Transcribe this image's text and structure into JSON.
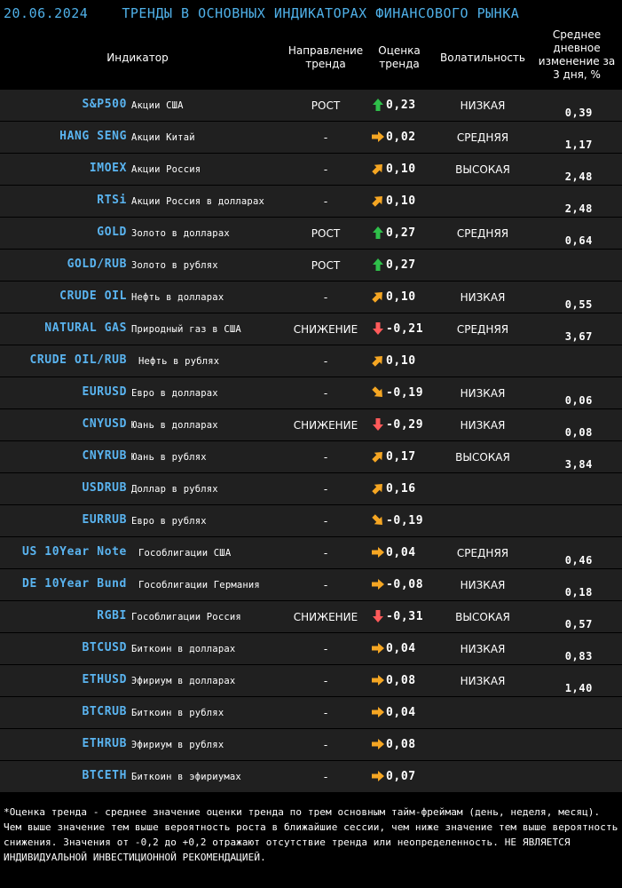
{
  "title_bar": {
    "date": "20.06.2024",
    "title": "ТРЕНДЫ В ОСНОВНЫХ ИНДИКАТОРАХ ФИНАНСОВОГО РЫНКА"
  },
  "columns": {
    "indicator": "Индикатор",
    "direction_line1": "Направление",
    "direction_line2": "тренда",
    "score_line1": "Оценка",
    "score_line2": "тренда",
    "volatility": "Волатильность",
    "avg_line1": "Среднее",
    "avg_line2": "дневное",
    "avg_line3": "изменение за",
    "avg_line4": "3 дня, %"
  },
  "colors": {
    "ticker": "#5ab4f0",
    "up_arrow": "#2fbf4a",
    "down_arrow": "#ff5a5a",
    "side_arrow": "#f5a623"
  },
  "rows": [
    {
      "ticker": "S&P500",
      "desc": "Акции США",
      "direction": "РОСТ",
      "arrow": "up",
      "score": "0,23",
      "volatility": "НИЗКАЯ",
      "avg": "0,39"
    },
    {
      "ticker": "HANG SENG",
      "desc": "Акции Китай",
      "direction": "-",
      "arrow": "right",
      "score": "0,02",
      "volatility": "СРЕДНЯЯ",
      "avg": "1,17"
    },
    {
      "ticker": "IMOEX",
      "desc": "Акции Россия",
      "direction": "-",
      "arrow": "up-right",
      "score": "0,10",
      "volatility": "ВЫСОКАЯ",
      "avg": "2,48"
    },
    {
      "ticker": "RTSi",
      "desc": "Акции Россия в долларах",
      "direction": "-",
      "arrow": "up-right",
      "score": "0,10",
      "volatility": "",
      "avg": "2,48"
    },
    {
      "ticker": "GOLD",
      "desc": "Золото в долларах",
      "direction": "РОСТ",
      "arrow": "up",
      "score": "0,27",
      "volatility": "СРЕДНЯЯ",
      "avg": "0,64"
    },
    {
      "ticker": "GOLD/RUB",
      "desc": "Золото в рублях",
      "direction": "РОСТ",
      "arrow": "up",
      "score": "0,27",
      "volatility": "",
      "avg": ""
    },
    {
      "ticker": "CRUDE OIL",
      "desc": "Нефть в долларах",
      "direction": "-",
      "arrow": "up-right",
      "score": "0,10",
      "volatility": "НИЗКАЯ",
      "avg": "0,55"
    },
    {
      "ticker": "NATURAL GAS",
      "desc": "Природный газ в США",
      "direction": "СНИЖЕНИЕ",
      "arrow": "down",
      "score": "-0,21",
      "volatility": "СРЕДНЯЯ",
      "avg": "3,67"
    },
    {
      "ticker": "CRUDE OIL/RUB",
      "desc": "Нефть в рублях",
      "direction": "-",
      "arrow": "up-right",
      "score": "0,10",
      "volatility": "",
      "avg": ""
    },
    {
      "ticker": "EURUSD",
      "desc": "Евро в долларах",
      "direction": "-",
      "arrow": "down-right",
      "score": "-0,19",
      "volatility": "НИЗКАЯ",
      "avg": "0,06"
    },
    {
      "ticker": "CNYUSD",
      "desc": "Юань в долларах",
      "direction": "СНИЖЕНИЕ",
      "arrow": "down",
      "score": "-0,29",
      "volatility": "НИЗКАЯ",
      "avg": "0,08"
    },
    {
      "ticker": "CNYRUB",
      "desc": "Юань в рублях",
      "direction": "-",
      "arrow": "up-right",
      "score": "0,17",
      "volatility": "ВЫСОКАЯ",
      "avg": "3,84"
    },
    {
      "ticker": "USDRUB",
      "desc": "Доллар в рублях",
      "direction": "-",
      "arrow": "up-right",
      "score": "0,16",
      "volatility": "",
      "avg": ""
    },
    {
      "ticker": "EURRUB",
      "desc": "Евро в рублях",
      "direction": "-",
      "arrow": "down-right",
      "score": "-0,19",
      "volatility": "",
      "avg": ""
    },
    {
      "ticker": "US 10Year Note",
      "desc": "Гособлигации США",
      "direction": "-",
      "arrow": "right",
      "score": "0,04",
      "volatility": "СРЕДНЯЯ",
      "avg": "0,46"
    },
    {
      "ticker": "DE 10Year Bund",
      "desc": "Гособлигации Германия",
      "direction": "-",
      "arrow": "right",
      "score": "-0,08",
      "volatility": "НИЗКАЯ",
      "avg": "0,18"
    },
    {
      "ticker": "RGBI",
      "desc": "Гособлигации Россия",
      "direction": "СНИЖЕНИЕ",
      "arrow": "down",
      "score": "-0,31",
      "volatility": "ВЫСОКАЯ",
      "avg": "0,57"
    },
    {
      "ticker": "BTCUSD",
      "desc": "Биткоин в долларах",
      "direction": "-",
      "arrow": "right",
      "score": "0,04",
      "volatility": "НИЗКАЯ",
      "avg": "0,83"
    },
    {
      "ticker": "ETHUSD",
      "desc": "Эфириум в долларах",
      "direction": "-",
      "arrow": "right",
      "score": "0,08",
      "volatility": "НИЗКАЯ",
      "avg": "1,40"
    },
    {
      "ticker": "BTCRUB",
      "desc": "Биткоин в рублях",
      "direction": "-",
      "arrow": "right",
      "score": "0,04",
      "volatility": "",
      "avg": ""
    },
    {
      "ticker": "ETHRUB",
      "desc": "Эфириум в рублях",
      "direction": "-",
      "arrow": "right",
      "score": "0,08",
      "volatility": "",
      "avg": ""
    },
    {
      "ticker": "BTCETH",
      "desc": "Биткоин в эфириумах",
      "direction": "-",
      "arrow": "right",
      "score": "0,07",
      "volatility": "",
      "avg": ""
    }
  ],
  "footnote": "*Оценка тренда - среднее значение оценки тренда по трем основным тайм-фреймам (день, неделя, месяц). Чем выше значение тем выше вероятность роста в ближайшие сессии, чем ниже значение тем выше вероятность снижения. Значения от -0,2 до +0,2 отражают отсутствие тренда или неопределенность. НЕ ЯВЛЯЕТСЯ ИНДИВИДУАЛЬНОЙ ИНВЕСТИЦИОННОЙ РЕКОМЕНДАЦИЕЙ."
}
